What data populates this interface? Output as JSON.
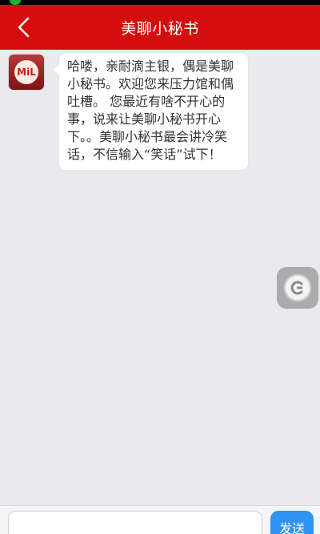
{
  "header": {
    "title": "美聊小秘书",
    "back_icon": "chevron-left-icon",
    "background_color": "#d40d0d"
  },
  "chat": {
    "avatar_text": "MiL",
    "messages": [
      {
        "sender": "bot",
        "text": "哈喽，亲耐滴主银，偶是美聊小秘书。欢迎您来压力馆和偶吐槽。 您最近有啥不开心的事，说来让美聊小秘书开心下。。美聊小秘书最会讲冷笑话，不信输入“笑话”试下！"
      }
    ]
  },
  "float_button": {
    "icon": "c-logo-icon"
  },
  "input_bar": {
    "input_value": "",
    "input_placeholder": "",
    "send_label": "发送",
    "send_color": "#2f93f3"
  }
}
